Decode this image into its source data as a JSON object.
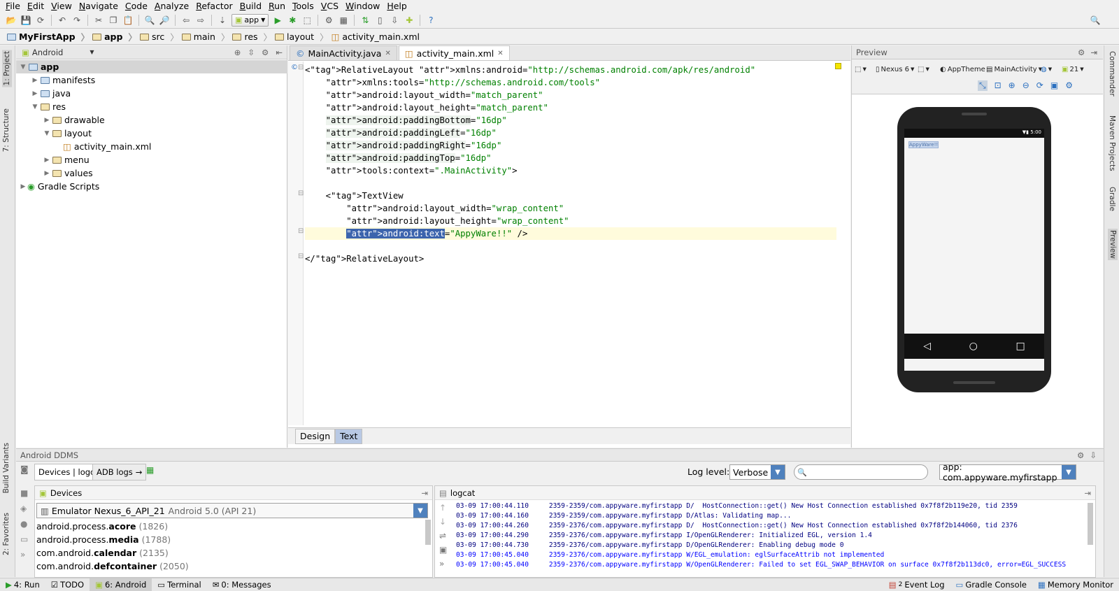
{
  "menu": [
    "File",
    "Edit",
    "View",
    "Navigate",
    "Code",
    "Analyze",
    "Refactor",
    "Build",
    "Run",
    "Tools",
    "VCS",
    "Window",
    "Help"
  ],
  "toolbar": {
    "run_config": "app"
  },
  "breadcrumb": [
    "MyFirstApp",
    "app",
    "src",
    "main",
    "res",
    "layout",
    "activity_main.xml"
  ],
  "project_panel": {
    "view_mode": "Android",
    "tree": [
      {
        "label": "app",
        "level": 0,
        "expanded": true,
        "selected": true
      },
      {
        "label": "manifests",
        "level": 1,
        "expanded": false
      },
      {
        "label": "java",
        "level": 1,
        "expanded": false
      },
      {
        "label": "res",
        "level": 1,
        "expanded": true
      },
      {
        "label": "drawable",
        "level": 2,
        "expanded": false
      },
      {
        "label": "layout",
        "level": 2,
        "expanded": true
      },
      {
        "label": "activity_main.xml",
        "level": 3,
        "file": true
      },
      {
        "label": "menu",
        "level": 2,
        "expanded": false
      },
      {
        "label": "values",
        "level": 2,
        "expanded": false
      },
      {
        "label": "Gradle Scripts",
        "level": 0,
        "expanded": false
      }
    ]
  },
  "left_tabs": [
    "1: Project",
    "7: Structure",
    "Build Variants",
    "2: Favorites"
  ],
  "right_tabs": [
    "Commander",
    "Maven Projects",
    "Gradle",
    "Preview"
  ],
  "editor": {
    "tabs": [
      {
        "label": "MainActivity.java",
        "active": false
      },
      {
        "label": "activity_main.xml",
        "active": true
      }
    ],
    "code_lines": [
      "<RelativeLayout xmlns:android=\"http://schemas.android.com/apk/res/android\"",
      "    xmlns:tools=\"http://schemas.android.com/tools\"",
      "    android:layout_width=\"match_parent\"",
      "    android:layout_height=\"match_parent\"",
      "    android:paddingBottom=\"16dp\"",
      "    android:paddingLeft=\"16dp\"",
      "    android:paddingRight=\"16dp\"",
      "    android:paddingTop=\"16dp\"",
      "    tools:context=\".MainActivity\">",
      "",
      "    <TextView",
      "        android:layout_width=\"wrap_content\"",
      "        android:layout_height=\"wrap_content\"",
      "        android:text=\"AppyWare!!\" />",
      "",
      "</RelativeLayout>"
    ],
    "bottom_tabs": [
      {
        "label": "Design",
        "active": false
      },
      {
        "label": "Text",
        "active": true
      }
    ]
  },
  "preview": {
    "title": "Preview",
    "device": "Nexus 6",
    "theme": "AppTheme",
    "activity": "MainActivity",
    "api": "21",
    "screen_text": "AppyWare!!",
    "clock": "5:00"
  },
  "ddms": {
    "title": "Android DDMS",
    "tabs": [
      "Devices | logcat",
      "ADB logs"
    ],
    "log_level_label": "Log level:",
    "log_level": "Verbose",
    "search_placeholder": "",
    "app_filter": "app: com.appyware.myfirstapp",
    "devices_title": "Devices",
    "device_name": "Emulator Nexus_6_API_21",
    "device_version": "Android 5.0 (API 21)",
    "processes": [
      {
        "prefix": "android.process.",
        "name": "acore",
        "pid": "(1826)"
      },
      {
        "prefix": "android.process.",
        "name": "media",
        "pid": "(1788)"
      },
      {
        "prefix": "com.android.",
        "name": "calendar",
        "pid": "(2135)"
      },
      {
        "prefix": "com.android.",
        "name": "defcontainer",
        "pid": "(2050)"
      }
    ],
    "logcat_title": "logcat",
    "log_lines": [
      {
        "text": "03-09 17:00:44.110     2359-2359/com.appyware.myfirstapp D/  HostConnection::get() New Host Connection established 0x7f8f2b119e20, tid 2359",
        "level": "d"
      },
      {
        "text": "03-09 17:00:44.160     2359-2359/com.appyware.myfirstapp D/Atlas: Validating map...",
        "level": "d"
      },
      {
        "text": "03-09 17:00:44.260     2359-2376/com.appyware.myfirstapp D/  HostConnection::get() New Host Connection established 0x7f8f2b144060, tid 2376",
        "level": "d"
      },
      {
        "text": "03-09 17:00:44.290     2359-2376/com.appyware.myfirstapp I/OpenGLRenderer: Initialized EGL, version 1.4",
        "level": "d"
      },
      {
        "text": "03-09 17:00:44.730     2359-2376/com.appyware.myfirstapp D/OpenGLRenderer: Enabling debug mode 0",
        "level": "d"
      },
      {
        "text": "03-09 17:00:45.040     2359-2376/com.appyware.myfirstapp W/EGL_emulation: eglSurfaceAttrib not implemented",
        "level": "w"
      },
      {
        "text": "03-09 17:00:45.040     2359-2376/com.appyware.myfirstapp W/OpenGLRenderer: Failed to set EGL_SWAP_BEHAVIOR on surface 0x7f8f2b113dc0, error=EGL_SUCCESS",
        "level": "w"
      }
    ]
  },
  "statusbar": {
    "left": [
      {
        "label": "4: Run",
        "icon": "run-icon"
      },
      {
        "label": "TODO",
        "icon": "todo-icon"
      },
      {
        "label": "6: Android",
        "icon": "android-icon",
        "active": true
      },
      {
        "label": "Terminal",
        "icon": "terminal-icon"
      },
      {
        "label": "0: Messages",
        "icon": "messages-icon"
      }
    ],
    "right": [
      {
        "label": "Event Log",
        "badge": "2"
      },
      {
        "label": "Gradle Console"
      },
      {
        "label": "Memory Monitor"
      }
    ]
  },
  "colors": {
    "accent": "#4f81bd",
    "selection": "#3c64ad",
    "android_green": "#a4c639"
  }
}
